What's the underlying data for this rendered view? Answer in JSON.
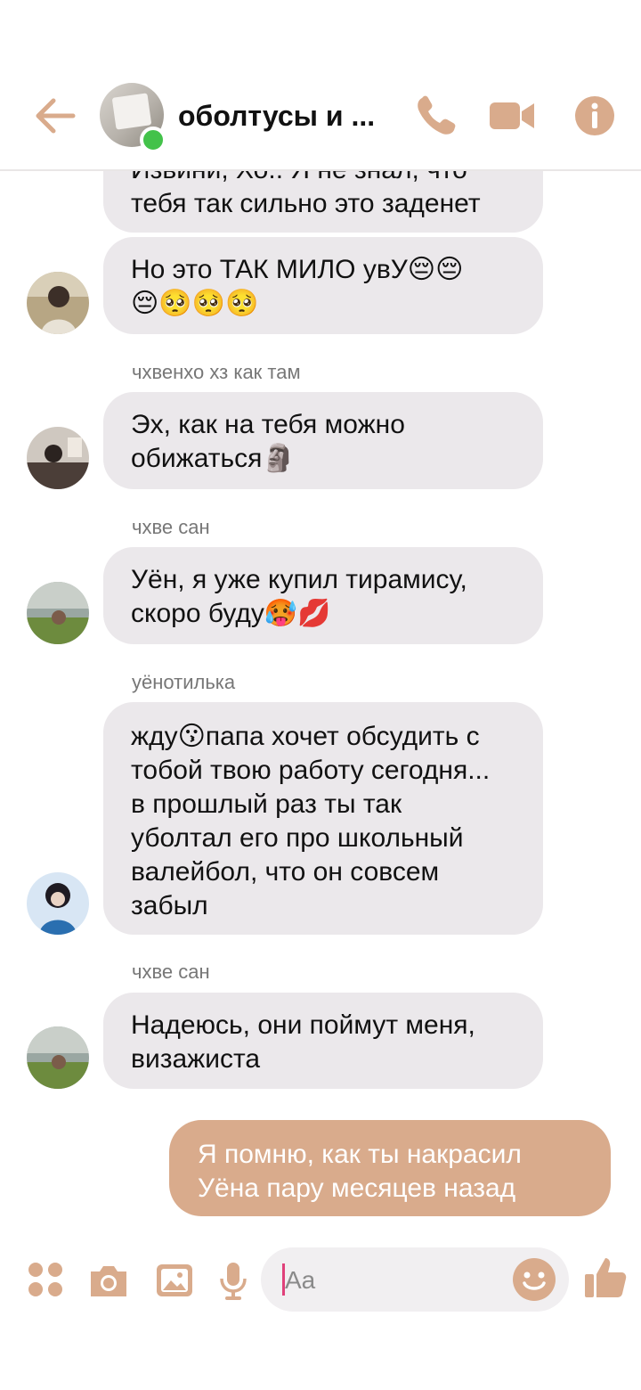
{
  "header": {
    "title": "оболтусы и ...",
    "back_icon": "arrow-left-icon",
    "call_icon": "phone-icon",
    "video_icon": "video-camera-icon",
    "info_icon": "info-icon",
    "accent_color": "#d9ab8c",
    "online_color": "#43c24a"
  },
  "messages": [
    {
      "lines": [
        "Извини, Хо.. Я не знал, что",
        "тебя так сильно это заденет"
      ]
    },
    {
      "lines": [
        "Но это ТАК МИЛО увУ😔😔",
        "😔🥺🥺🥺"
      ]
    },
    {
      "sender": "чхвенхо хз как там",
      "lines": [
        "Эх, как на тебя можно",
        "обижаться🗿"
      ]
    },
    {
      "sender": "чхве сан",
      "lines": [
        "Уён, я уже купил тирамису,",
        "скоро буду🥵💋"
      ]
    },
    {
      "sender": "уёнотилька",
      "lines": [
        "жду😗папа хочет обсудить с",
        "тобой твою работу сегодня...",
        "в прошлый раз ты так",
        "уболтал его про школьный",
        "валейбол, что он совсем",
        "забыл"
      ]
    },
    {
      "sender": "чхве сан",
      "lines": [
        "Надеюсь, они поймут меня,",
        "визажиста"
      ]
    }
  ],
  "outgoing": {
    "lines": [
      "Я помню, как ты накрасил",
      "Уёна пару месяцев назад"
    ]
  },
  "composer": {
    "placeholder": "Aa",
    "icons": [
      "grid-menu-icon",
      "camera-icon",
      "image-icon",
      "microphone-icon",
      "smiley-icon",
      "thumbs-up-icon"
    ]
  }
}
